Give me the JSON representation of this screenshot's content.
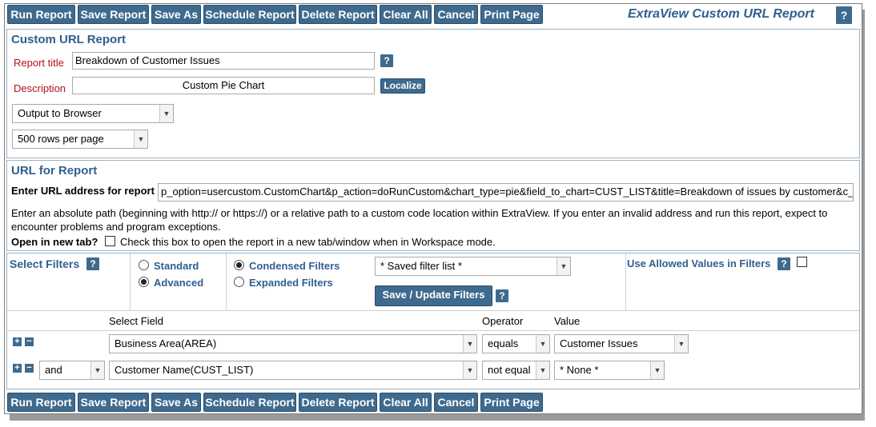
{
  "toolbar": {
    "run": "Run Report",
    "save": "Save Report",
    "save_as": "Save As",
    "schedule": "Schedule Report",
    "delete": "Delete Report",
    "clear": "Clear All",
    "cancel": "Cancel",
    "print": "Print Page"
  },
  "header": {
    "title": "ExtraView Custom URL Report",
    "help": "?"
  },
  "custom_report": {
    "title": "Custom URL Report",
    "report_title_label": "Report title",
    "report_title_value": "Breakdown of Customer Issues",
    "description_label": "Description",
    "description_value": "Custom Pie Chart",
    "localize": "Localize",
    "help": "?",
    "output": "Output to Browser",
    "rows": "500 rows per page"
  },
  "url_section": {
    "title": "URL for Report",
    "url_label": "Enter URL address for report",
    "url_value": "p_option=usercustom.CustomChart&p_action=doRunCustom&chart_type=pie&field_to_chart=CUST_LIST&title=Breakdown of issues by customer&c_",
    "help_text": "Enter an absolute path (beginning with http:// or https://) or a relative path to a custom code location within ExtraView. If you enter an invalid address and run this report, expect to encounter problems and program exceptions.",
    "open_tab_label": "Open in new tab?",
    "open_tab_help": "Check this box to open the report in a new tab/window when in Workspace mode."
  },
  "filters": {
    "title": "Select Filters",
    "help": "?",
    "standard": "Standard",
    "advanced": "Advanced",
    "condensed": "Condensed Filters",
    "expanded": "Expanded Filters",
    "saved_list": "* Saved filter list *",
    "save_update": "Save / Update Filters",
    "allowed_values": "Use Allowed Values in Filters",
    "col_field": "Select Field",
    "col_operator": "Operator",
    "col_value": "Value",
    "rows": [
      {
        "connector": "",
        "field": "Business Area(AREA)",
        "operator": "equals",
        "value": "Customer Issues"
      },
      {
        "connector": "and",
        "field": "Customer Name(CUST_LIST)",
        "operator": "not equal",
        "value": "* None *"
      }
    ]
  }
}
